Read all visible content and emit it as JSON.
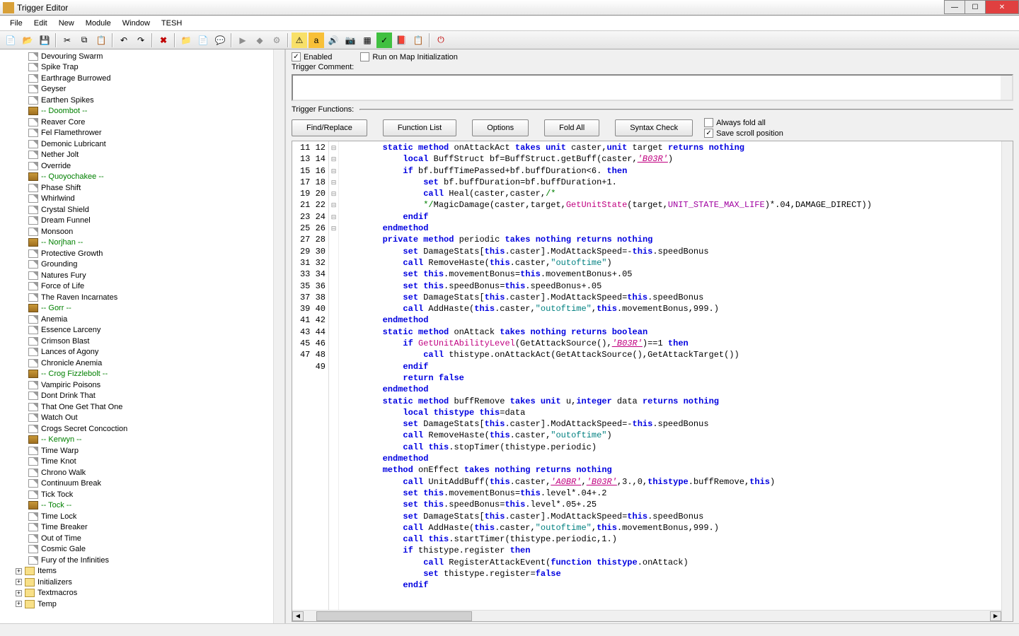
{
  "window": {
    "title": "Trigger Editor"
  },
  "menu": {
    "items": [
      "File",
      "Edit",
      "New",
      "Module",
      "Window",
      "TESH"
    ]
  },
  "tree": {
    "items": [
      {
        "label": "Devouring Swarm",
        "type": "page"
      },
      {
        "label": "Spike Trap",
        "type": "page"
      },
      {
        "label": "Earthrage Burrowed",
        "type": "page"
      },
      {
        "label": "Geyser",
        "type": "page"
      },
      {
        "label": "Earthen Spikes",
        "type": "page"
      },
      {
        "label": "-- Doombot --",
        "type": "cat"
      },
      {
        "label": "Reaver Core",
        "type": "page"
      },
      {
        "label": "Fel Flamethrower",
        "type": "page"
      },
      {
        "label": "Demonic Lubricant",
        "type": "page"
      },
      {
        "label": "Nether Jolt",
        "type": "page"
      },
      {
        "label": "Override",
        "type": "page"
      },
      {
        "label": "-- Quoyochakee --",
        "type": "cat"
      },
      {
        "label": "Phase Shift",
        "type": "page"
      },
      {
        "label": "Whirlwind",
        "type": "page"
      },
      {
        "label": "Crystal Shield",
        "type": "page"
      },
      {
        "label": "Dream Funnel",
        "type": "page"
      },
      {
        "label": "Monsoon",
        "type": "page"
      },
      {
        "label": "-- Norjhan --",
        "type": "cat"
      },
      {
        "label": "Protective Growth",
        "type": "page"
      },
      {
        "label": "Grounding",
        "type": "page"
      },
      {
        "label": "Natures Fury",
        "type": "page"
      },
      {
        "label": "Force of Life",
        "type": "page"
      },
      {
        "label": "The Raven Incarnates",
        "type": "page"
      },
      {
        "label": "-- Gorr --",
        "type": "cat"
      },
      {
        "label": "Anemia",
        "type": "page"
      },
      {
        "label": "Essence Larceny",
        "type": "page"
      },
      {
        "label": "Crimson Blast",
        "type": "page"
      },
      {
        "label": "Lances of Agony",
        "type": "page"
      },
      {
        "label": "Chronicle Anemia",
        "type": "page"
      },
      {
        "label": "-- Crog Fizzlebolt --",
        "type": "cat"
      },
      {
        "label": "Vampiric Poisons",
        "type": "page"
      },
      {
        "label": "Dont Drink That",
        "type": "page"
      },
      {
        "label": "That One Get That One",
        "type": "page"
      },
      {
        "label": "Watch Out",
        "type": "page"
      },
      {
        "label": "Crogs Secret Concoction",
        "type": "page"
      },
      {
        "label": "-- Kerwyn --",
        "type": "cat"
      },
      {
        "label": "Time Warp",
        "type": "page"
      },
      {
        "label": "Time Knot",
        "type": "page"
      },
      {
        "label": "Chrono Walk",
        "type": "page"
      },
      {
        "label": "Continuum Break",
        "type": "page"
      },
      {
        "label": "Tick Tock",
        "type": "page"
      },
      {
        "label": "-- Tock --",
        "type": "cat"
      },
      {
        "label": "Time Lock",
        "type": "page"
      },
      {
        "label": "Time Breaker",
        "type": "page"
      },
      {
        "label": "Out of Time",
        "type": "page"
      },
      {
        "label": "Cosmic Gale",
        "type": "page"
      },
      {
        "label": "Fury of the Infinities",
        "type": "page"
      }
    ],
    "folders": [
      "Items",
      "Initializers",
      "Textmacros",
      "Temp"
    ]
  },
  "controls": {
    "enabled": "Enabled",
    "runOnInit": "Run on Map Initialization",
    "commentLabel": "Trigger Comment:",
    "functionsLabel": "Trigger Functions:",
    "buttons": {
      "findReplace": "Find/Replace",
      "functionList": "Function List",
      "options": "Options",
      "foldAll": "Fold All",
      "syntaxCheck": "Syntax Check"
    },
    "alwaysFold": "Always fold all",
    "saveScroll": "Save scroll position"
  },
  "code": {
    "startLine": 11,
    "lines": [
      {
        "n": 11,
        "f": "",
        "t": "        <kw>static</kw> <kw>method</kw> onAttackAct <kw>takes</kw> <ty>unit</ty> caster,<ty>unit</ty> target <kw>returns</kw> <ty>nothing</ty>"
      },
      {
        "n": 12,
        "f": "",
        "t": "            <kw>local</kw> BuffStruct bf=BuffStruct.getBuff(caster,<lit>'B03R'</lit>)"
      },
      {
        "n": 13,
        "f": "-",
        "t": "            <kw>if</kw> bf.buffTimePassed+bf.buffDuration&lt;6. <kw>then</kw>"
      },
      {
        "n": 14,
        "f": "",
        "t": "                <kw>set</kw> bf.buffDuration=bf.buffDuration+1."
      },
      {
        "n": 15,
        "f": "-",
        "t": "                <kw>call</kw> Heal(caster,caster,<cm>/*</cm>"
      },
      {
        "n": 16,
        "f": "",
        "t": "                <cm>*/</cm>MagicDamage(caster,target,<nat>GetUnitState</nat>(target,<pur>UNIT_STATE_MAX_LIFE</pur>)*.04,DAMAGE_DIRECT))"
      },
      {
        "n": 17,
        "f": "",
        "t": "            <kw>endif</kw>"
      },
      {
        "n": 18,
        "f": "",
        "t": "        <kw>endmethod</kw>"
      },
      {
        "n": 19,
        "f": "-",
        "t": "        <kw>private</kw> <kw>method</kw> periodic <kw>takes</kw> <ty>nothing</ty> <kw>returns</kw> <ty>nothing</ty>"
      },
      {
        "n": 20,
        "f": "",
        "t": "            <kw>set</kw> DamageStats[<kw>this</kw>.caster].ModAttackSpeed=-<kw>this</kw>.speedBonus"
      },
      {
        "n": 21,
        "f": "",
        "t": "            <kw>call</kw> RemoveHaste(<kw>this</kw>.caster,<str>\"outoftime\"</str>)"
      },
      {
        "n": 22,
        "f": "",
        "t": "            <kw>set</kw> <kw>this</kw>.movementBonus=<kw>this</kw>.movementBonus+.05"
      },
      {
        "n": 23,
        "f": "",
        "t": "            <kw>set</kw> <kw>this</kw>.speedBonus=<kw>this</kw>.speedBonus+.05"
      },
      {
        "n": 24,
        "f": "",
        "t": "            <kw>set</kw> DamageStats[<kw>this</kw>.caster].ModAttackSpeed=<kw>this</kw>.speedBonus"
      },
      {
        "n": 25,
        "f": "",
        "t": "            <kw>call</kw> AddHaste(<kw>this</kw>.caster,<str>\"outoftime\"</str>,<kw>this</kw>.movementBonus,999.)"
      },
      {
        "n": 26,
        "f": "",
        "t": "        <kw>endmethod</kw>"
      },
      {
        "n": 27,
        "f": "-",
        "t": "        <kw>static</kw> <kw>method</kw> onAttack <kw>takes</kw> <ty>nothing</ty> <kw>returns</kw> <ty>boolean</ty>"
      },
      {
        "n": 28,
        "f": "-",
        "t": "            <kw>if</kw> <nat>GetUnitAbilityLevel</nat>(GetAttackSource(),<lit>'B03R'</lit>)==1 <kw>then</kw>"
      },
      {
        "n": 29,
        "f": "",
        "t": "                <kw>call</kw> thistype.onAttackAct(GetAttackSource(),GetAttackTarget())"
      },
      {
        "n": 30,
        "f": "",
        "t": "            <kw>endif</kw>"
      },
      {
        "n": 31,
        "f": "",
        "t": "            <kw>return</kw> <kw>false</kw>"
      },
      {
        "n": 32,
        "f": "",
        "t": "        <kw>endmethod</kw>"
      },
      {
        "n": 33,
        "f": "-",
        "t": "        <kw>static</kw> <kw>method</kw> buffRemove <kw>takes</kw> <ty>unit</ty> u,<ty>integer</ty> data <kw>returns</kw> <ty>nothing</ty>"
      },
      {
        "n": 34,
        "f": "",
        "t": "            <kw>local</kw> <kw>thistype</kw> <kw>this</kw>=data"
      },
      {
        "n": 35,
        "f": "",
        "t": "            <kw>set</kw> DamageStats[<kw>this</kw>.caster].ModAttackSpeed=-<kw>this</kw>.speedBonus"
      },
      {
        "n": 36,
        "f": "",
        "t": "            <kw>call</kw> RemoveHaste(<kw>this</kw>.caster,<str>\"outoftime\"</str>)"
      },
      {
        "n": 37,
        "f": "",
        "t": "            <kw>call</kw> <kw>this</kw>.stopTimer(thistype.periodic)"
      },
      {
        "n": 38,
        "f": "",
        "t": "        <kw>endmethod</kw>"
      },
      {
        "n": 39,
        "f": "-",
        "t": "        <kw>method</kw> onEffect <kw>takes</kw> <ty>nothing</ty> <kw>returns</kw> <ty>nothing</ty>"
      },
      {
        "n": 40,
        "f": "",
        "t": "            <kw>call</kw> UnitAddBuff(<kw>this</kw>.caster,<lit>'A0BR'</lit>,<lit>'B03R'</lit>,3.,0,<kw>thistype</kw>.buffRemove,<kw>this</kw>)"
      },
      {
        "n": 41,
        "f": "",
        "t": "            <kw>set</kw> <kw>this</kw>.movementBonus=<kw>this</kw>.level*.04+.2"
      },
      {
        "n": 42,
        "f": "",
        "t": "            <kw>set</kw> <kw>this</kw>.speedBonus=<kw>this</kw>.level*.05+.25"
      },
      {
        "n": 43,
        "f": "",
        "t": "            <kw>set</kw> DamageStats[<kw>this</kw>.caster].ModAttackSpeed=<kw>this</kw>.speedBonus"
      },
      {
        "n": 44,
        "f": "",
        "t": "            <kw>call</kw> AddHaste(<kw>this</kw>.caster,<str>\"outoftime\"</str>,<kw>this</kw>.movementBonus,999.)"
      },
      {
        "n": 45,
        "f": "",
        "t": "            <kw>call</kw> <kw>this</kw>.startTimer(thistype.periodic,1.)"
      },
      {
        "n": 46,
        "f": "-",
        "t": "            <kw>if</kw> thistype.register <kw>then</kw>"
      },
      {
        "n": 47,
        "f": "",
        "t": "                <kw>call</kw> RegisterAttackEvent(<kw>function</kw> <kw>thistype</kw>.onAttack)"
      },
      {
        "n": 48,
        "f": "",
        "t": "                <kw>set</kw> thistype.register=<kw>false</kw>"
      },
      {
        "n": 49,
        "f": "",
        "t": "            <kw>endif</kw>"
      }
    ]
  }
}
